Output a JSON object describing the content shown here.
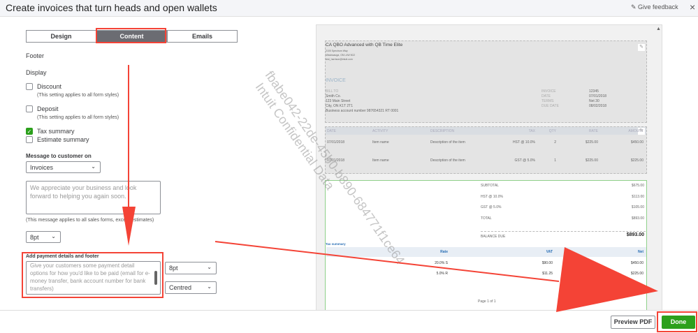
{
  "header": {
    "title": "Create invoices that turn heads and open wallets",
    "feedback": "Give feedback",
    "close": "×"
  },
  "tabs": [
    {
      "label": "Design"
    },
    {
      "label": "Content"
    },
    {
      "label": "Emails"
    }
  ],
  "left": {
    "section": "Footer",
    "display": "Display",
    "discount": "Discount",
    "discount_note": "(This setting applies to all form styles)",
    "deposit": "Deposit",
    "deposit_note": "(This setting applies to all form styles)",
    "tax_summary": "Tax summary",
    "estimate_summary": "Estimate summary",
    "message_label": "Message to customer on",
    "message_form": "Invoices",
    "message_text": "We appreciate your business and look forward to helping you again soon.",
    "message_note": "(This message applies to all sales forms, except estimates)",
    "message_size": "8pt",
    "payment_label": "Add payment details and footer",
    "payment_placeholder": "Give your customers some payment detail options for how you'd like to be paid (email for e-money transfer, bank account number for bank transfers)",
    "payment_size": "8pt",
    "payment_align": "Centred"
  },
  "invoice": {
    "company": "CA QBO Advanced with QB Time Elite",
    "addr1": "2100 Spectrum Way",
    "addr2": "Mississauga, ON L4W 5G2",
    "email": "test_harrison@intuit.com",
    "title": "INVOICE",
    "bill_to": "BILL TO",
    "cust": [
      "Smith Co.",
      "123 Main Street",
      "City, ON K1T 2T1",
      "Business account number 987654321 RT 0001"
    ],
    "meta": [
      [
        "INVOICE",
        "12345"
      ],
      [
        "DATE",
        "07/01/2018"
      ],
      [
        "TERMS",
        "Net 30"
      ],
      [
        "DUE DATE",
        "08/02/2018"
      ]
    ],
    "cols": [
      "DATE",
      "ACTIVITY",
      "DESCRIPTION",
      "TAX",
      "QTY",
      "RATE",
      "AMOUNT"
    ],
    "rows": [
      [
        "07/01/2018",
        "Item name",
        "Description of the item",
        "HST @ 10.0%",
        "2",
        "$225.00",
        "$450.00"
      ],
      [
        "07/01/2018",
        "Item name",
        "Description of the item",
        "GST @ 5.0%",
        "1",
        "$225.00",
        "$225.00"
      ]
    ],
    "totals": [
      [
        "SUBTOTAL",
        "$675.00"
      ],
      [
        "HST @ 10.0%",
        "$113.00"
      ],
      [
        "GST @ 5.0%",
        "$105.00"
      ],
      [
        "TOTAL",
        "$893.00"
      ]
    ],
    "balance_label": "BALANCE DUE",
    "balance": "$893.00",
    "tax_summary": "Tax summary",
    "tax_cols": [
      "Rate",
      "VAT",
      "Net"
    ],
    "tax_rows": [
      [
        "20.0% S",
        "$90.00",
        "$450.00"
      ],
      [
        "5.0% R",
        "$11.25",
        "$225.00"
      ]
    ],
    "page": "Page 1 of 1"
  },
  "watermark": [
    "fbabe042-22de-45b0-b890-684771f1ce64",
    "Intuit Confidential Data"
  ],
  "footer": {
    "preview": "Preview PDF",
    "done": "Done"
  },
  "colors": {
    "accent": "#2ca01c",
    "annotation": "#f44336"
  }
}
